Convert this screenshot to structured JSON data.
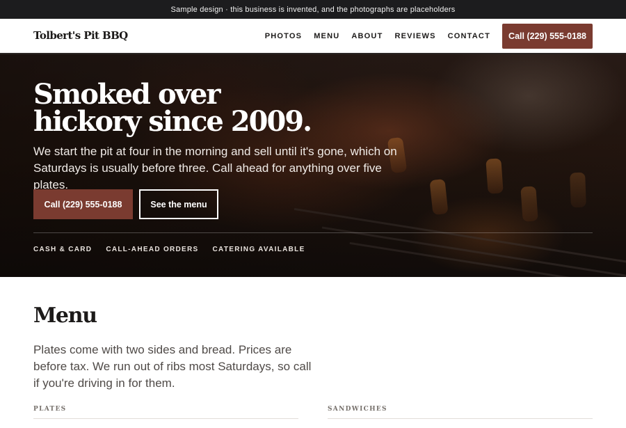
{
  "notice": "Sample design · this business is invented, and the photographs are placeholders",
  "brand": "Tolbert's Pit BBQ",
  "nav": {
    "items": [
      "PHOTOS",
      "MENU",
      "ABOUT",
      "REVIEWS",
      "CONTACT"
    ],
    "call_button": "Call  (229) 555-0188"
  },
  "hero": {
    "title_line1": "Smoked over",
    "title_line2": "hickory since 2009.",
    "lede": "We start the pit at four in the morning and sell until it's gone, which on Saturdays is usually before three. Call ahead for anything over five plates.",
    "primary_button": "Call (229) 555-0188",
    "secondary_button": "See the menu",
    "tags": [
      "CASH & CARD",
      "CALL-AHEAD ORDERS",
      "CATERING AVAILABLE"
    ]
  },
  "menu": {
    "title": "Menu",
    "intro": "Plates come with two sides and bread. Prices are before tax. We run out of ribs most Saturdays, so call if you're driving in for them.",
    "columns": [
      "PLATES",
      "SANDWICHES"
    ]
  },
  "colors": {
    "accent": "#7a3b30",
    "notice_bar": "#1c1c1e",
    "text": "#1c1a19"
  }
}
